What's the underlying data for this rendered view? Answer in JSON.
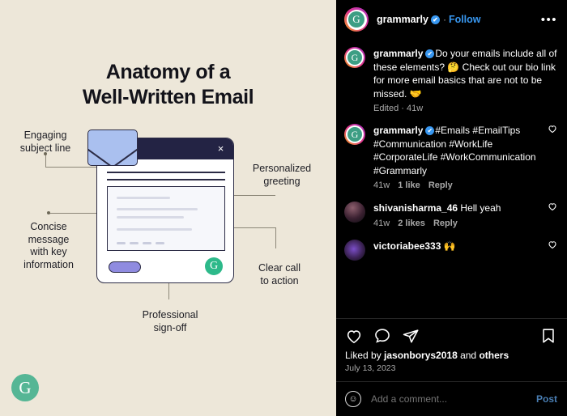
{
  "post_image": {
    "title_line1": "Anatomy of a",
    "title_line2": "Well-Written Email",
    "brand_logo_letter": "G",
    "close_icon_glyph": "×",
    "email_g_letter": "G",
    "callouts": [
      {
        "id": "engaging-subject-line",
        "text_line1": "Engaging",
        "text_line2": "subject line"
      },
      {
        "id": "personalized-greeting",
        "text_line1": "Personalized",
        "text_line2": "greeting"
      },
      {
        "id": "concise-message",
        "text_line1": "Concise",
        "text_line2": "message",
        "text_line3": "with key",
        "text_line4": "information"
      },
      {
        "id": "clear-call-to-action",
        "text_line1": "Clear call",
        "text_line2": "to action"
      },
      {
        "id": "professional-sign-off",
        "text_line1": "Professional",
        "text_line2": "sign-off"
      }
    ]
  },
  "header": {
    "username": "grammarly",
    "verified_glyph": "✔",
    "separator": "·",
    "follow_label": "Follow",
    "more_label": "•••",
    "avatar_letter": "G"
  },
  "caption": {
    "username": "grammarly",
    "text": "Do your emails include all of these elements? 🤔 Check out our bio link for more email basics that are not to be missed. 🤝",
    "meta": "Edited · 41w",
    "avatar_letter": "G"
  },
  "comments": [
    {
      "username": "grammarly",
      "verified": true,
      "avatar_type": "grammarly",
      "avatar_letter": "G",
      "text": "#Emails #EmailTips #Communication #WorkLife #CorporateLife #WorkCommunication #Grammarly",
      "time": "41w",
      "likes": "1 like",
      "reply_label": "Reply"
    },
    {
      "username": "shivanisharma_46",
      "verified": false,
      "avatar_type": "photo-a",
      "avatar_letter": "",
      "text": "Hell yeah",
      "time": "41w",
      "likes": "2 likes",
      "reply_label": "Reply"
    },
    {
      "username": "victoriabee333",
      "verified": false,
      "avatar_type": "photo-b",
      "avatar_letter": "",
      "text": "🙌",
      "time": "",
      "likes": "",
      "reply_label": ""
    }
  ],
  "actions": {
    "like_icon": "heart-icon",
    "comment_icon": "comment-icon",
    "share_icon": "share-icon",
    "bookmark_icon": "bookmark-icon"
  },
  "likes": {
    "prefix": "Liked by ",
    "user": "jasonborys2018",
    "middle": " and ",
    "suffix": "others",
    "date": "July 13, 2023"
  },
  "add_comment": {
    "emoji_glyph": "☺",
    "placeholder": "Add a comment...",
    "post_label": "Post"
  },
  "colors": {
    "image_background": "#EDE7D9",
    "panel_background": "#000000",
    "accent_blue": "#3897f0",
    "grammarly_green": "#55b695",
    "email_navy": "#232344",
    "envelope_blue": "#aac0ef",
    "send_purple": "#8f8be0"
  }
}
